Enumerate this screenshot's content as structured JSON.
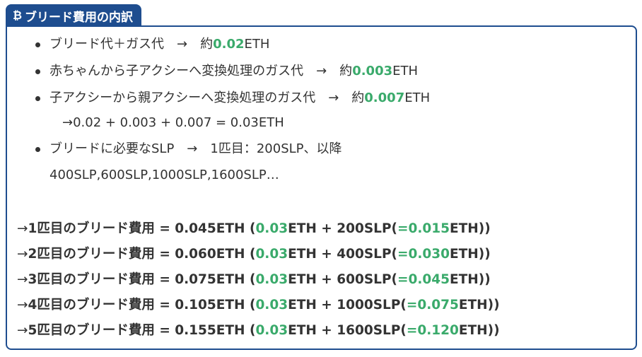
{
  "tab": {
    "icon": "bitcoin-icon",
    "title": "ブリード費用の内訳"
  },
  "bullets": [
    {
      "pre": "ブリード代＋ガス代　→　約",
      "value": "0.02",
      "post": "ETH"
    },
    {
      "pre": "赤ちゃんから子アクシーへ変換処理のガス代　→　約",
      "value": "0.003",
      "post": "ETH"
    },
    {
      "pre": "子アクシーから親アクシーへ変換処理のガス代　→　約",
      "value": "0.007",
      "post": "ETH"
    }
  ],
  "calc": "→0.02 + 0.003 + 0.007 = 0.03ETH",
  "slp_line1": "ブリードに必要なSLP　→　1匹目：200SLP、以降",
  "slp_line2": "400SLP,600SLP,1000SLP,1600SLP…",
  "summary": [
    {
      "arrow": "→",
      "label": "1匹目のブリード費用 = 0.045ETH (",
      "eth": "0.03",
      "mid": "ETH + 200SLP(",
      "slp_eth": "=0.015",
      "end": "ETH))"
    },
    {
      "arrow": "→",
      "label": "2匹目のブリード費用 = 0.060ETH (",
      "eth": "0.03",
      "mid": "ETH + 400SLP(",
      "slp_eth": "=0.030",
      "end": "ETH))"
    },
    {
      "arrow": "→",
      "label": "3匹目のブリード費用 = 0.075ETH (",
      "eth": "0.03",
      "mid": "ETH + 600SLP(",
      "slp_eth": "=0.045",
      "end": "ETH))"
    },
    {
      "arrow": "→",
      "label": "4匹目のブリード費用 = 0.105ETH (",
      "eth": "0.03",
      "mid": "ETH + 1000SLP(",
      "slp_eth": "=0.075",
      "end": "ETH))"
    },
    {
      "arrow": "→",
      "label": "5匹目のブリード費用 = 0.155ETH (",
      "eth": "0.03",
      "mid": "ETH + 1600SLP(",
      "slp_eth": "=0.120",
      "end": "ETH))"
    }
  ],
  "colors": {
    "accent": "#1e4d8f",
    "highlight": "#3aaa6b",
    "text": "#333333"
  }
}
